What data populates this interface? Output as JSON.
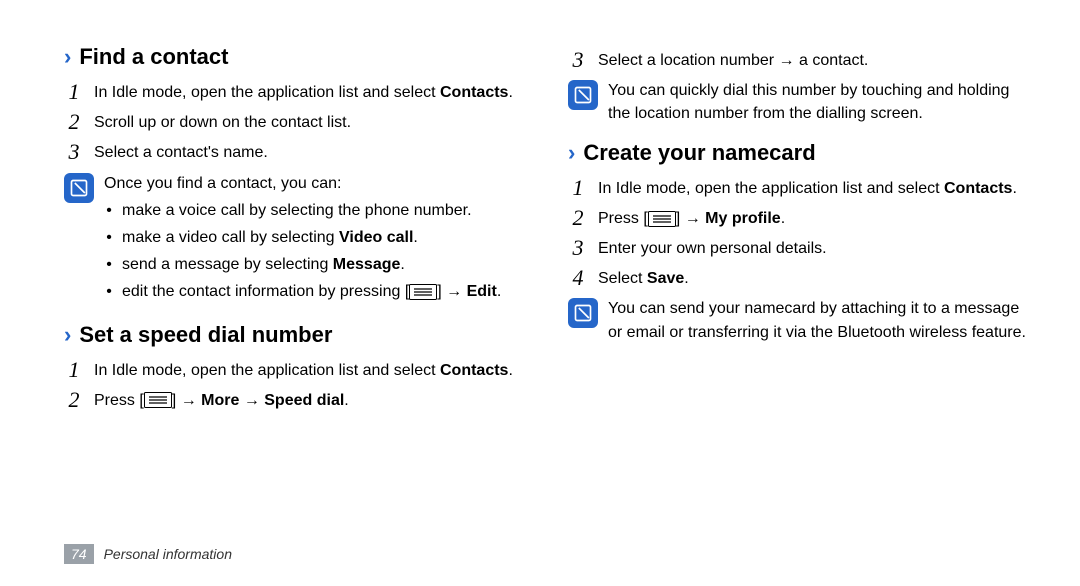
{
  "icons": {
    "arrow": "›",
    "bullet": "•",
    "arrow_right": "→"
  },
  "left": {
    "section1": {
      "title": "Find a contact",
      "steps": {
        "s1": {
          "num": "1",
          "pre": "In Idle mode, open the application list and select ",
          "bold": "Contacts",
          "post": "."
        },
        "s2": {
          "num": "2",
          "text": "Scroll up or down on the contact list."
        },
        "s3": {
          "num": "3",
          "text": "Select a contact's name."
        }
      },
      "note": {
        "intro": "Once you find a contact, you can:",
        "bullets": {
          "b1": "make a voice call by selecting the phone number.",
          "b2_pre": "make a video call by selecting ",
          "b2_bold": "Video call",
          "b2_post": ".",
          "b3_pre": "send a message by selecting ",
          "b3_bold": "Message",
          "b3_post": ".",
          "b4_pre": "edit the contact information by pressing [",
          "b4_mid": "] → ",
          "b4_bold": "Edit",
          "b4_post": "."
        }
      }
    },
    "section2": {
      "title": "Set a speed dial number",
      "steps": {
        "s1": {
          "num": "1",
          "pre": "In Idle mode, open the application list and select ",
          "bold": "Contacts",
          "post": "."
        },
        "s2": {
          "num": "2",
          "pre": "Press [",
          "mid": "] → ",
          "bold": "More → Speed dial",
          "post": "."
        }
      }
    }
  },
  "right": {
    "cont_step": {
      "num": "3",
      "text": "Select a location number → a contact."
    },
    "note1": "You can quickly dial this number by touching and holding the location number from the dialling screen.",
    "section3": {
      "title": "Create your namecard",
      "steps": {
        "s1": {
          "num": "1",
          "pre": "In Idle mode, open the application list and select ",
          "bold": "Contacts",
          "post": "."
        },
        "s2": {
          "num": "2",
          "pre": "Press [",
          "mid": "] → ",
          "bold": "My profile",
          "post": "."
        },
        "s3": {
          "num": "3",
          "text": "Enter your own personal details."
        },
        "s4": {
          "num": "4",
          "pre": "Select ",
          "bold": "Save",
          "post": "."
        }
      },
      "note": "You can send your namecard by attaching it to a message or email or transferring it via the Bluetooth wireless feature."
    }
  },
  "footer": {
    "page": "74",
    "label": "Personal information"
  }
}
